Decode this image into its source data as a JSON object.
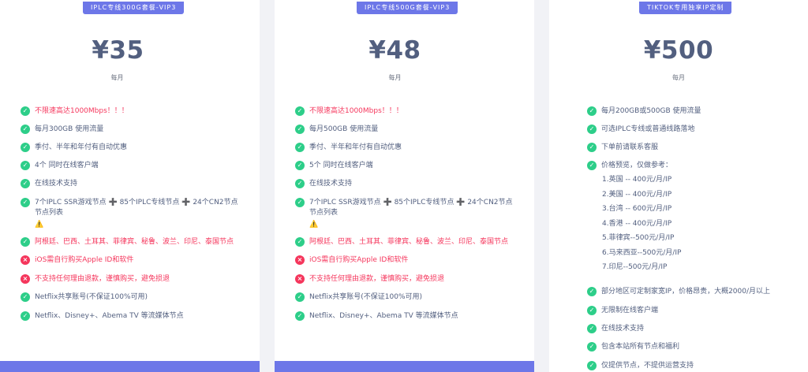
{
  "plans": [
    {
      "badge": "IPLC专线300G套餐-VIP3",
      "price": "¥35",
      "period": "每月",
      "features": [
        {
          "type": "ok",
          "style": "red",
          "text": "不限速高达1000Mbps！！！"
        },
        {
          "type": "ok",
          "style": "",
          "text": "每月300GB 使用流量"
        },
        {
          "type": "ok",
          "style": "",
          "text": "季付、半年和年付有自动优惠"
        },
        {
          "type": "ok",
          "style": "",
          "text": "4个 同时在线客户端"
        },
        {
          "type": "ok",
          "style": "",
          "text": "在线技术支持"
        },
        {
          "type": "ok",
          "style": "",
          "text": "7个IPLC SSR游戏节点 ➕ 85个IPLC专线节点 ➕ 24个CN2节点节点列表",
          "warn": "⚠️"
        },
        {
          "type": "ok",
          "style": "red",
          "text": "阿根廷、巴西、土耳其、菲律宾、秘鲁、波兰、印尼、泰国节点"
        },
        {
          "type": "no",
          "style": "red",
          "text": "iOS需自行购买Apple ID和软件"
        },
        {
          "type": "no",
          "style": "red",
          "text": "不支持任何理由退款，谨慎购买，避免损退"
        },
        {
          "type": "ok",
          "style": "",
          "text": "Netflix共享账号(不保证100%可用)"
        },
        {
          "type": "ok",
          "style": "",
          "text": "Netflix、Disney+、Abema TV 等流媒体节点"
        }
      ]
    },
    {
      "badge": "IPLC专线500G套餐-VIP3",
      "price": "¥48",
      "period": "每月",
      "features": [
        {
          "type": "ok",
          "style": "red",
          "text": "不限速高达1000Mbps！！！"
        },
        {
          "type": "ok",
          "style": "",
          "text": "每月500GB 使用流量"
        },
        {
          "type": "ok",
          "style": "",
          "text": "季付、半年和年付有自动优惠"
        },
        {
          "type": "ok",
          "style": "",
          "text": "5个 同时在线客户端"
        },
        {
          "type": "ok",
          "style": "",
          "text": "在线技术支持"
        },
        {
          "type": "ok",
          "style": "",
          "text": "7个IPLC SSR游戏节点 ➕ 85个IPLC专线节点 ➕ 24个CN2节点节点列表",
          "warn": "⚠️"
        },
        {
          "type": "ok",
          "style": "red",
          "text": "阿根廷、巴西、土耳其、菲律宾、秘鲁、波兰、印尼、泰国节点"
        },
        {
          "type": "no",
          "style": "red",
          "text": "iOS需自行购买Apple ID和软件"
        },
        {
          "type": "no",
          "style": "red",
          "text": "不支持任何理由退款，谨慎购买，避免损退"
        },
        {
          "type": "ok",
          "style": "",
          "text": "Netflix共享账号(不保证100%可用)"
        },
        {
          "type": "ok",
          "style": "",
          "text": "Netflix、Disney+、Abema TV 等流媒体节点"
        }
      ]
    },
    {
      "badge": "TIKTOK专用独享IP定制",
      "price": "¥500",
      "period": "每月",
      "features": [
        {
          "type": "ok",
          "style": "",
          "text": "每月200GB或500GB 使用流量"
        },
        {
          "type": "ok",
          "style": "",
          "text": "可选IPLC专线或普通线路落地"
        },
        {
          "type": "ok",
          "style": "",
          "text": "下单前请联系客服"
        },
        {
          "type": "ok",
          "style": "",
          "text": "价格预览，仅做参考："
        },
        {
          "type": "ok",
          "style": "",
          "text": "部分地区可定制家宽IP，价格昂贵，大概2000/月以上"
        },
        {
          "type": "ok",
          "style": "",
          "text": "无限制在线客户端"
        },
        {
          "type": "ok",
          "style": "",
          "text": "在线技术支持"
        },
        {
          "type": "ok",
          "style": "",
          "text": "包含本站所有节点和福利"
        },
        {
          "type": "ok",
          "style": "",
          "text": "仅提供节点，不提供运营支持"
        }
      ],
      "price_list": [
        "1.英国 -- 400元/月/IP",
        "2.美国 -- 400元/月/IP",
        "3.台湾 -- 600元/月/IP",
        "4.香港 -- 400元/月/IP",
        "5.菲律宾--500元/月/IP",
        "6.马来西亚--500元/月/IP",
        "7.印尼--500元/月/IP"
      ]
    }
  ],
  "colors": {
    "accent": "#6d77e8",
    "ok": "#2dce89",
    "no": "#f5365c",
    "text": "#525f7f"
  }
}
